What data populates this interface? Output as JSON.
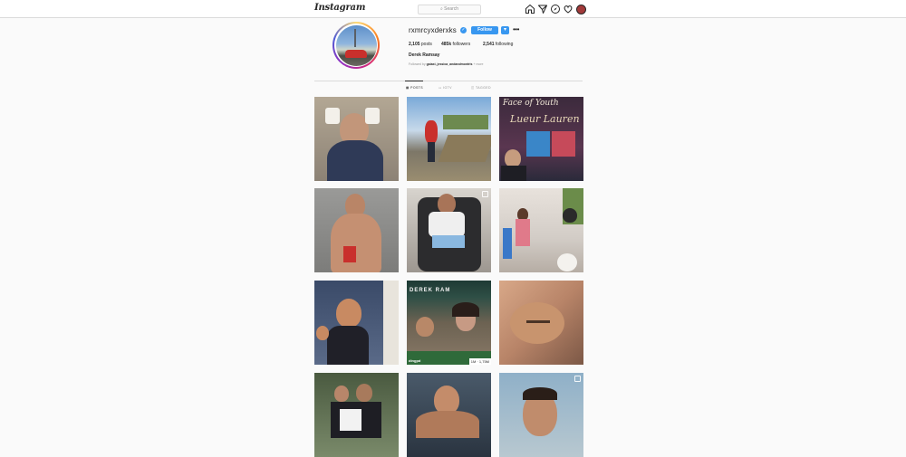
{
  "nav": {
    "logo": "Instagram",
    "search_placeholder": "Search",
    "icons": [
      "home-icon",
      "direct-icon",
      "explore-icon",
      "activity-icon",
      "profile-avatar"
    ]
  },
  "profile": {
    "username": "rxmrcyxderxks",
    "verified": true,
    "follow_label": "Follow",
    "more_label": "▾",
    "options_label": "•••",
    "stats": {
      "posts": "2,105",
      "posts_label": "posts",
      "followers": "485k",
      "followers_label": "followers",
      "following": "2,541",
      "following_label": "following"
    },
    "full_name": "Derek Ramsay",
    "followed_by_prefix": "Followed by",
    "followed_by_names": "gaiaxi, jessica_andandmontris",
    "followed_by_suffix": "+ more"
  },
  "tabs": [
    {
      "label": "POSTS",
      "active": true
    },
    {
      "label": "IGTV",
      "active": false
    },
    {
      "label": "TAGGED",
      "active": false
    }
  ],
  "grid": {
    "overlays": {
      "post3_title": "Face of Youth",
      "post3_brand": "Lueur Lauren",
      "post8_banner": "DEREK RAM",
      "post8_caption": "dingpd",
      "post8_views": "1M · 1,75M"
    }
  },
  "colors": {
    "accent": "#3897f0",
    "border": "#dbdbdb",
    "background": "#fafafa"
  }
}
